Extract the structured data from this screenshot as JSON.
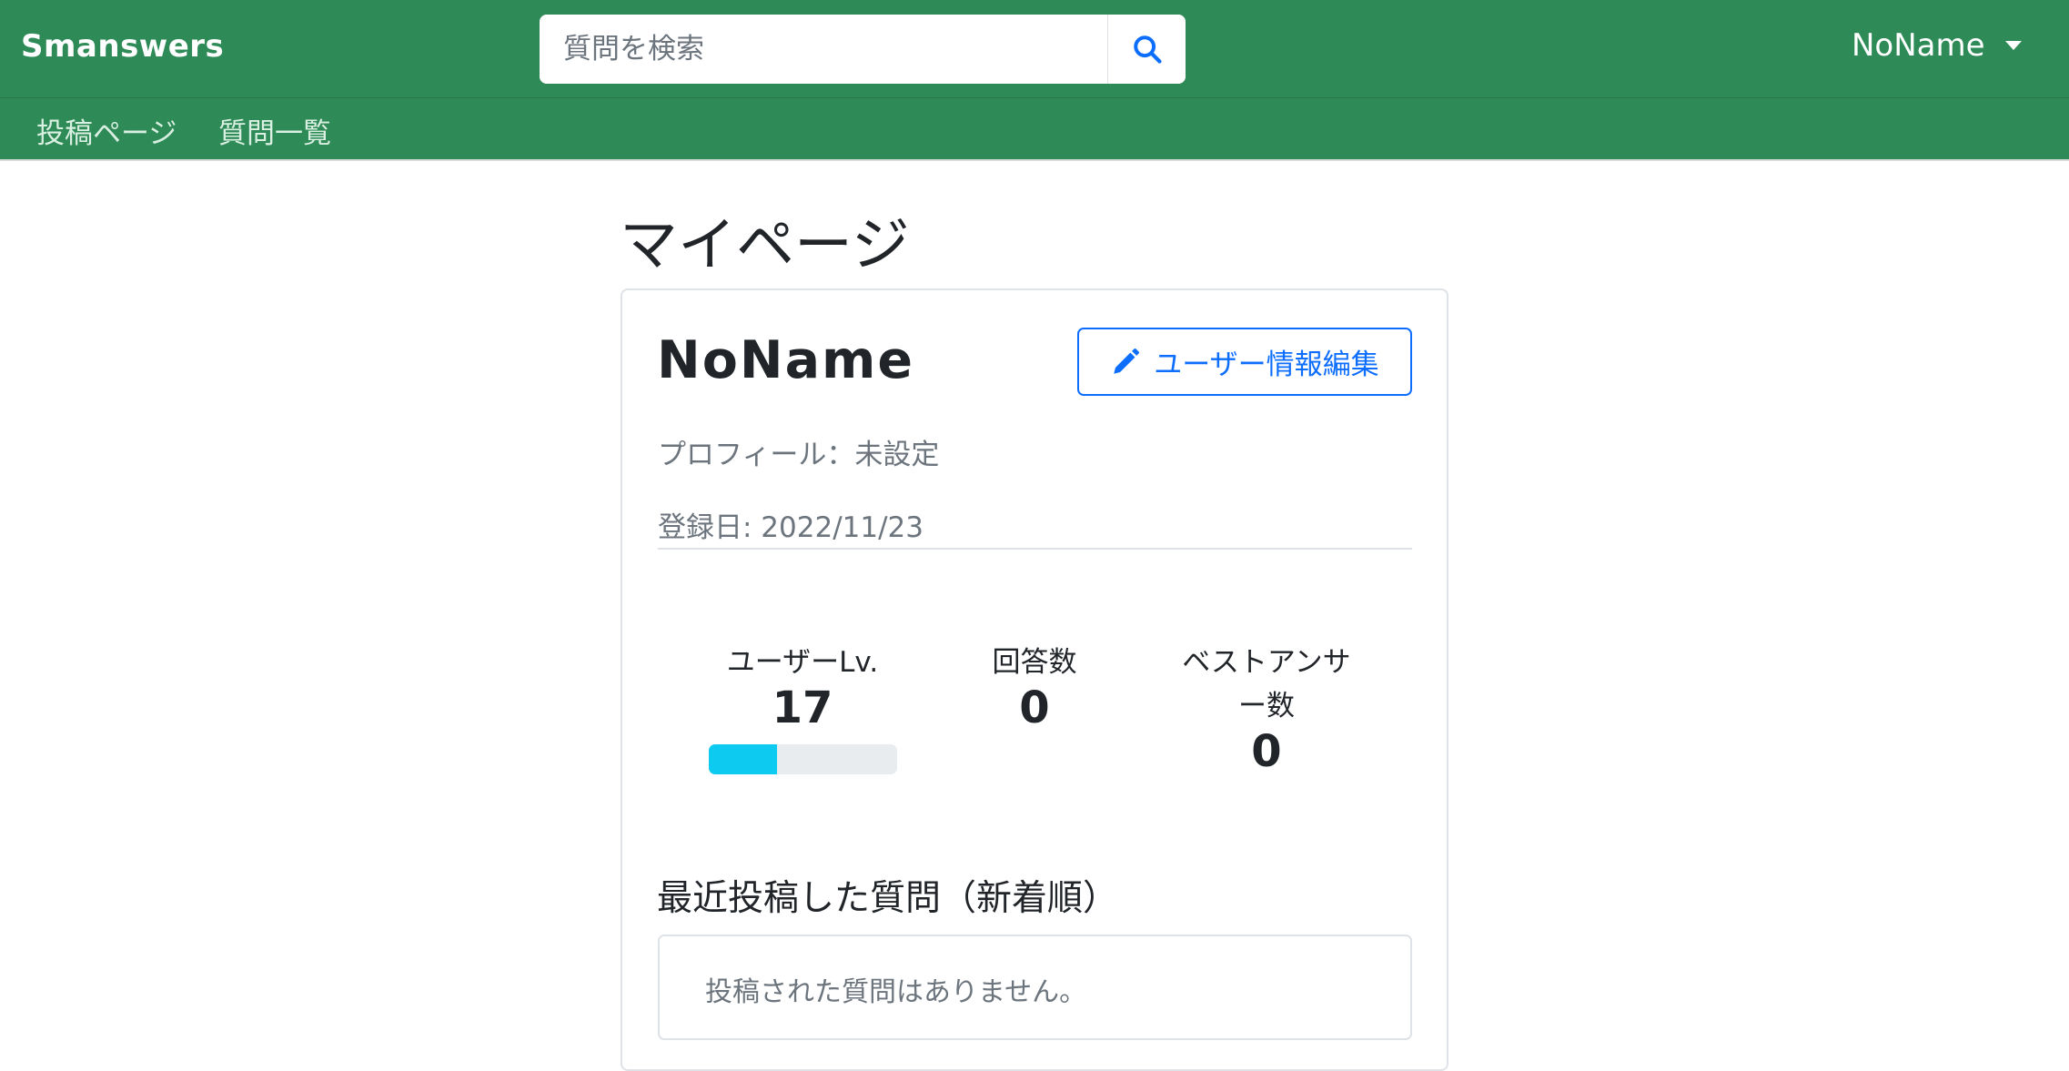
{
  "navbar": {
    "brand": "Smanswers",
    "search": {
      "placeholder": "質問を検索",
      "value": ""
    },
    "user_menu": "NoName"
  },
  "subnav": {
    "links": [
      "投稿ページ",
      "質問一覧"
    ]
  },
  "page": {
    "title": "マイページ"
  },
  "profile": {
    "name": "NoName",
    "edit_button": "ユーザー情報編集",
    "profile_text": "プロフィール：未設定",
    "registered": "登録日: 2022/11/23"
  },
  "stats": {
    "level_label": "ユーザーLv.",
    "level_value": "17",
    "level_progress": 0.36,
    "answers_label": "回答数",
    "answers_value": "0",
    "best_label_line1": "ベストアンサ",
    "best_label_line2": "ー数",
    "best_value": "0"
  },
  "recent": {
    "heading": "最近投稿した質問（新着順）",
    "empty_message": "投稿された質問はありません。"
  },
  "colors": {
    "navbar": "#2e8b57",
    "primary": "#0d6efd",
    "progress": "#0dcaf0"
  }
}
